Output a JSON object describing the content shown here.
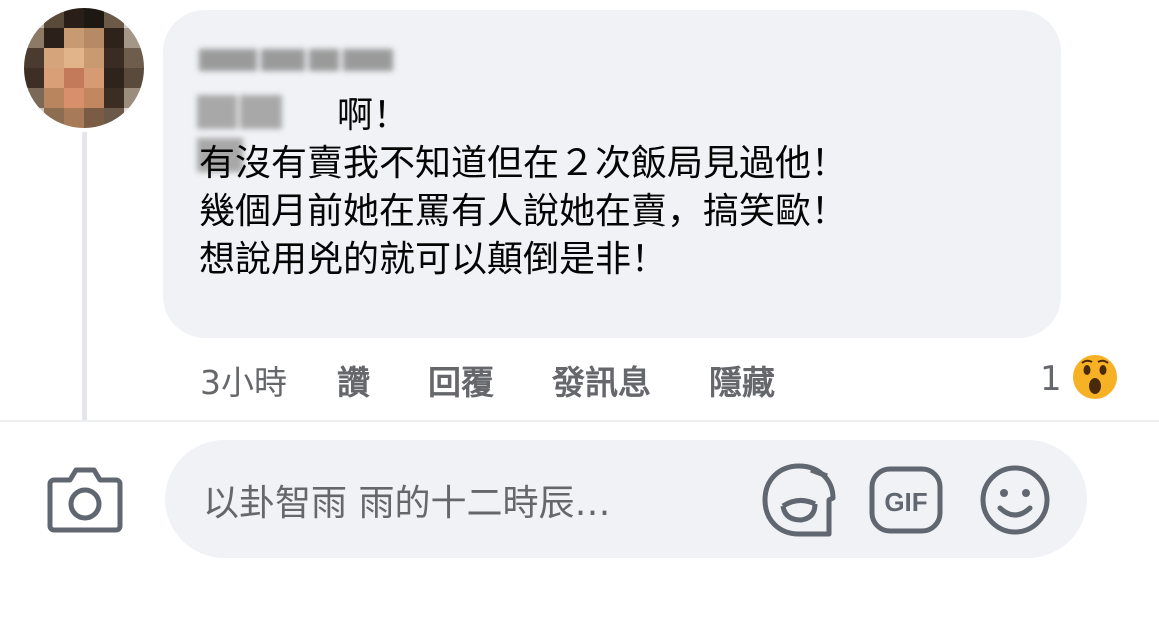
{
  "comment": {
    "line1": "啊！",
    "line2": "有沒有賣我不知道但在２次飯局見過他！",
    "line3": "幾個月前她在罵有人說她在賣，搞笑歐！",
    "line4": "想說用兇的就可以顛倒是非！"
  },
  "actions": {
    "time": "3小時",
    "like": "讚",
    "reply": "回覆",
    "message": "發訊息",
    "hide": "隱藏"
  },
  "reaction": {
    "count": "1",
    "icon": "wow-emoji-icon",
    "color": "#f7b125"
  },
  "composer": {
    "placeholder": "以卦智雨 雨的十二時辰…",
    "icons": [
      "camera-icon",
      "sticker-icon",
      "gif-icon",
      "emoji-icon"
    ],
    "gif_label": "GIF"
  },
  "colors": {
    "bubble": "#f0f2f5",
    "text": "#050505",
    "meta": "#65676b"
  }
}
